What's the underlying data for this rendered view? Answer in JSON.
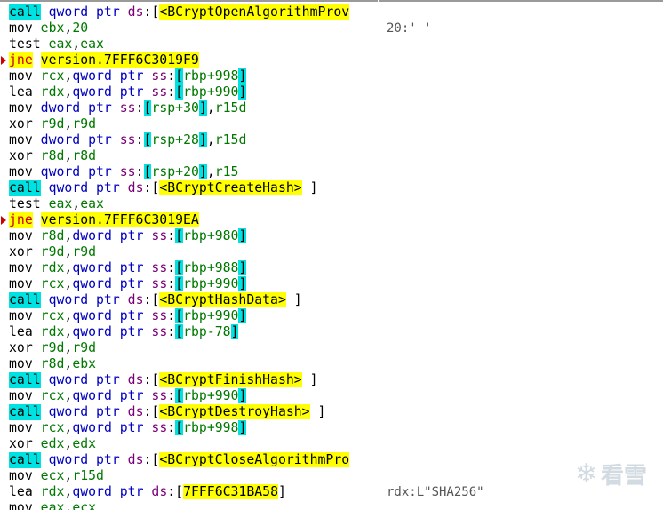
{
  "lines": [
    {
      "m": "call",
      "p": [
        {
          "t": "qword ptr",
          "c": "kw"
        },
        {
          "t": " "
        },
        {
          "t": "ds",
          "c": "seg"
        },
        {
          "t": ":["
        },
        {
          "t": "<BCryptOpenAlgorithmProv",
          "c": "hl-yellow"
        }
      ],
      "type": "call"
    },
    {
      "m": "mov",
      "p": [
        {
          "t": "ebx",
          "c": "reg"
        },
        {
          "t": ","
        },
        {
          "t": "20",
          "c": "num"
        }
      ]
    },
    {
      "m": "test",
      "p": [
        {
          "t": "eax",
          "c": "reg"
        },
        {
          "t": ","
        },
        {
          "t": "eax",
          "c": "reg"
        }
      ]
    },
    {
      "m": "jne",
      "p": [
        {
          "t": "version.7FFF6C3019F9",
          "c": "hl-yellow"
        }
      ],
      "type": "jne",
      "arrow": true
    },
    {
      "m": "mov",
      "p": [
        {
          "t": "rcx",
          "c": "reg"
        },
        {
          "t": ","
        },
        {
          "t": "qword ptr",
          "c": "kw"
        },
        {
          "t": " "
        },
        {
          "t": "ss",
          "c": "seg"
        },
        {
          "t": ":"
        },
        {
          "t": "[",
          "c": "br-cyan"
        },
        {
          "t": "rbp+998",
          "c": "reg"
        },
        {
          "t": "]",
          "c": "br-cyan"
        }
      ]
    },
    {
      "m": "lea",
      "p": [
        {
          "t": "rdx",
          "c": "reg"
        },
        {
          "t": ","
        },
        {
          "t": "qword ptr",
          "c": "kw"
        },
        {
          "t": " "
        },
        {
          "t": "ss",
          "c": "seg"
        },
        {
          "t": ":"
        },
        {
          "t": "[",
          "c": "br-cyan"
        },
        {
          "t": "rbp+990",
          "c": "reg"
        },
        {
          "t": "]",
          "c": "br-cyan"
        }
      ]
    },
    {
      "m": "mov",
      "p": [
        {
          "t": "dword ptr",
          "c": "kw"
        },
        {
          "t": " "
        },
        {
          "t": "ss",
          "c": "seg"
        },
        {
          "t": ":"
        },
        {
          "t": "[",
          "c": "br-cyan"
        },
        {
          "t": "rsp+30",
          "c": "reg"
        },
        {
          "t": "]",
          "c": "br-cyan"
        },
        {
          "t": ","
        },
        {
          "t": "r15d",
          "c": "reg"
        }
      ]
    },
    {
      "m": "xor",
      "p": [
        {
          "t": "r9d",
          "c": "reg"
        },
        {
          "t": ","
        },
        {
          "t": "r9d",
          "c": "reg"
        }
      ]
    },
    {
      "m": "mov",
      "p": [
        {
          "t": "dword ptr",
          "c": "kw"
        },
        {
          "t": " "
        },
        {
          "t": "ss",
          "c": "seg"
        },
        {
          "t": ":"
        },
        {
          "t": "[",
          "c": "br-cyan"
        },
        {
          "t": "rsp+28",
          "c": "reg"
        },
        {
          "t": "]",
          "c": "br-cyan"
        },
        {
          "t": ","
        },
        {
          "t": "r15d",
          "c": "reg"
        }
      ]
    },
    {
      "m": "xor",
      "p": [
        {
          "t": "r8d",
          "c": "reg"
        },
        {
          "t": ","
        },
        {
          "t": "r8d",
          "c": "reg"
        }
      ]
    },
    {
      "m": "mov",
      "p": [
        {
          "t": "qword ptr",
          "c": "kw"
        },
        {
          "t": " "
        },
        {
          "t": "ss",
          "c": "seg"
        },
        {
          "t": ":"
        },
        {
          "t": "[",
          "c": "br-cyan"
        },
        {
          "t": "rsp+20",
          "c": "reg"
        },
        {
          "t": "]",
          "c": "br-cyan"
        },
        {
          "t": ","
        },
        {
          "t": "r15",
          "c": "reg"
        }
      ]
    },
    {
      "m": "call",
      "p": [
        {
          "t": "qword ptr",
          "c": "kw"
        },
        {
          "t": " "
        },
        {
          "t": "ds",
          "c": "seg"
        },
        {
          "t": ":["
        },
        {
          "t": "<BCryptCreateHash>",
          "c": "hl-yellow"
        },
        {
          "t": " ]"
        }
      ],
      "type": "call"
    },
    {
      "m": "test",
      "p": [
        {
          "t": "eax",
          "c": "reg"
        },
        {
          "t": ","
        },
        {
          "t": "eax",
          "c": "reg"
        }
      ]
    },
    {
      "m": "jne",
      "p": [
        {
          "t": "version.7FFF6C3019EA",
          "c": "hl-yellow"
        }
      ],
      "type": "jne",
      "arrow": true
    },
    {
      "m": "mov",
      "p": [
        {
          "t": "r8d",
          "c": "reg"
        },
        {
          "t": ","
        },
        {
          "t": "dword ptr",
          "c": "kw"
        },
        {
          "t": " "
        },
        {
          "t": "ss",
          "c": "seg"
        },
        {
          "t": ":"
        },
        {
          "t": "[",
          "c": "br-cyan"
        },
        {
          "t": "rbp+980",
          "c": "reg"
        },
        {
          "t": "]",
          "c": "br-cyan"
        }
      ]
    },
    {
      "m": "xor",
      "p": [
        {
          "t": "r9d",
          "c": "reg"
        },
        {
          "t": ","
        },
        {
          "t": "r9d",
          "c": "reg"
        }
      ]
    },
    {
      "m": "mov",
      "p": [
        {
          "t": "rdx",
          "c": "reg"
        },
        {
          "t": ","
        },
        {
          "t": "qword ptr",
          "c": "kw"
        },
        {
          "t": " "
        },
        {
          "t": "ss",
          "c": "seg"
        },
        {
          "t": ":"
        },
        {
          "t": "[",
          "c": "br-cyan"
        },
        {
          "t": "rbp+988",
          "c": "reg"
        },
        {
          "t": "]",
          "c": "br-cyan"
        }
      ]
    },
    {
      "m": "mov",
      "p": [
        {
          "t": "rcx",
          "c": "reg"
        },
        {
          "t": ","
        },
        {
          "t": "qword ptr",
          "c": "kw"
        },
        {
          "t": " "
        },
        {
          "t": "ss",
          "c": "seg"
        },
        {
          "t": ":"
        },
        {
          "t": "[",
          "c": "br-cyan"
        },
        {
          "t": "rbp+990",
          "c": "reg"
        },
        {
          "t": "]",
          "c": "br-cyan"
        }
      ]
    },
    {
      "m": "call",
      "p": [
        {
          "t": "qword ptr",
          "c": "kw"
        },
        {
          "t": " "
        },
        {
          "t": "ds",
          "c": "seg"
        },
        {
          "t": ":["
        },
        {
          "t": "<BCryptHashData>",
          "c": "hl-yellow"
        },
        {
          "t": " ]"
        }
      ],
      "type": "call"
    },
    {
      "m": "mov",
      "p": [
        {
          "t": "rcx",
          "c": "reg"
        },
        {
          "t": ","
        },
        {
          "t": "qword ptr",
          "c": "kw"
        },
        {
          "t": " "
        },
        {
          "t": "ss",
          "c": "seg"
        },
        {
          "t": ":"
        },
        {
          "t": "[",
          "c": "br-cyan"
        },
        {
          "t": "rbp+990",
          "c": "reg"
        },
        {
          "t": "]",
          "c": "br-cyan"
        }
      ]
    },
    {
      "m": "lea",
      "p": [
        {
          "t": "rdx",
          "c": "reg"
        },
        {
          "t": ","
        },
        {
          "t": "qword ptr",
          "c": "kw"
        },
        {
          "t": " "
        },
        {
          "t": "ss",
          "c": "seg"
        },
        {
          "t": ":"
        },
        {
          "t": "[",
          "c": "br-cyan"
        },
        {
          "t": "rbp-78",
          "c": "reg"
        },
        {
          "t": "]",
          "c": "br-cyan"
        }
      ]
    },
    {
      "m": "xor",
      "p": [
        {
          "t": "r9d",
          "c": "reg"
        },
        {
          "t": ","
        },
        {
          "t": "r9d",
          "c": "reg"
        }
      ]
    },
    {
      "m": "mov",
      "p": [
        {
          "t": "r8d",
          "c": "reg"
        },
        {
          "t": ","
        },
        {
          "t": "ebx",
          "c": "reg"
        }
      ]
    },
    {
      "m": "call",
      "p": [
        {
          "t": "qword ptr",
          "c": "kw"
        },
        {
          "t": " "
        },
        {
          "t": "ds",
          "c": "seg"
        },
        {
          "t": ":["
        },
        {
          "t": "<BCryptFinishHash>",
          "c": "hl-yellow"
        },
        {
          "t": " ]"
        }
      ],
      "type": "call"
    },
    {
      "m": "mov",
      "p": [
        {
          "t": "rcx",
          "c": "reg"
        },
        {
          "t": ","
        },
        {
          "t": "qword ptr",
          "c": "kw"
        },
        {
          "t": " "
        },
        {
          "t": "ss",
          "c": "seg"
        },
        {
          "t": ":"
        },
        {
          "t": "[",
          "c": "br-cyan"
        },
        {
          "t": "rbp+990",
          "c": "reg"
        },
        {
          "t": "]",
          "c": "br-cyan"
        }
      ]
    },
    {
      "m": "call",
      "p": [
        {
          "t": "qword ptr",
          "c": "kw"
        },
        {
          "t": " "
        },
        {
          "t": "ds",
          "c": "seg"
        },
        {
          "t": ":["
        },
        {
          "t": "<BCryptDestroyHash>",
          "c": "hl-yellow"
        },
        {
          "t": " ]"
        }
      ],
      "type": "call"
    },
    {
      "m": "mov",
      "p": [
        {
          "t": "rcx",
          "c": "reg"
        },
        {
          "t": ","
        },
        {
          "t": "qword ptr",
          "c": "kw"
        },
        {
          "t": " "
        },
        {
          "t": "ss",
          "c": "seg"
        },
        {
          "t": ":"
        },
        {
          "t": "[",
          "c": "br-cyan"
        },
        {
          "t": "rbp+998",
          "c": "reg"
        },
        {
          "t": "]",
          "c": "br-cyan"
        }
      ]
    },
    {
      "m": "xor",
      "p": [
        {
          "t": "edx",
          "c": "reg"
        },
        {
          "t": ","
        },
        {
          "t": "edx",
          "c": "reg"
        }
      ]
    },
    {
      "m": "call",
      "p": [
        {
          "t": "qword ptr",
          "c": "kw"
        },
        {
          "t": " "
        },
        {
          "t": "ds",
          "c": "seg"
        },
        {
          "t": ":["
        },
        {
          "t": "<BCryptCloseAlgorithmPro",
          "c": "hl-yellow"
        }
      ],
      "type": "call"
    },
    {
      "m": "mov",
      "p": [
        {
          "t": "ecx",
          "c": "reg"
        },
        {
          "t": ","
        },
        {
          "t": "r15d",
          "c": "reg"
        }
      ]
    },
    {
      "m": "lea",
      "p": [
        {
          "t": "rdx",
          "c": "reg"
        },
        {
          "t": ","
        },
        {
          "t": "qword ptr",
          "c": "kw"
        },
        {
          "t": " "
        },
        {
          "t": "ds",
          "c": "seg"
        },
        {
          "t": ":["
        },
        {
          "t": "7FFF6C31BA58",
          "c": "hl-yellow"
        },
        {
          "t": "]"
        }
      ]
    },
    {
      "m": "mov",
      "p": [
        {
          "t": "eax",
          "c": "reg"
        },
        {
          "t": ","
        },
        {
          "t": "ecx",
          "c": "reg"
        }
      ]
    }
  ],
  "comments": [
    {
      "line": 1,
      "text": "20:' '"
    },
    {
      "line": 30,
      "text": "rdx:L\"SHA256\""
    }
  ],
  "watermark": {
    "icon": "snowflake-icon",
    "text": "看雪"
  },
  "colors": {
    "call_bg": "#00e1e1",
    "jne_bg": "#ffff00",
    "jne_fg": "#cc0000",
    "highlight": "#ffff00"
  }
}
